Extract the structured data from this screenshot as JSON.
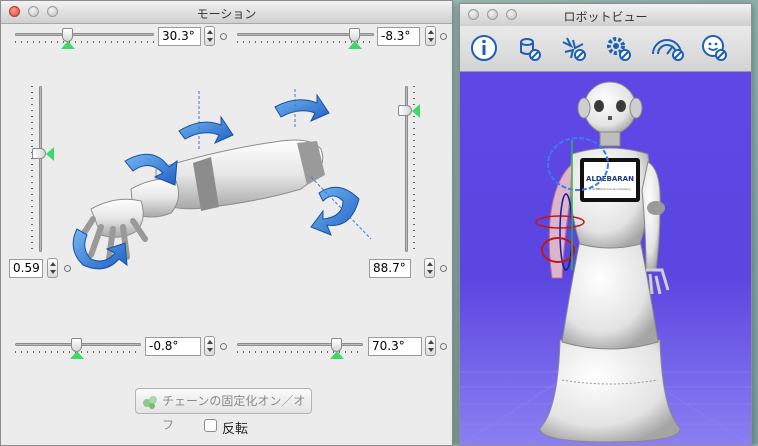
{
  "motion_window": {
    "title": "モーション",
    "sliders": {
      "top_left": {
        "value": "30.3°",
        "level": 0.38
      },
      "top_right": {
        "value": "-8.3°",
        "level": 0.86
      },
      "left_vert": {
        "value": "0.59",
        "level": 0.41
      },
      "right_vert": {
        "value": "88.7°",
        "level": 0.15
      },
      "bot_left": {
        "value": "-0.8°",
        "level": 0.49
      },
      "bot_right": {
        "value": "70.3°",
        "level": 0.79
      }
    },
    "chain_lock_button": "チェーンの固定化オン／オフ",
    "mirror_checkbox": {
      "label": "反転",
      "checked": false
    }
  },
  "robot_window": {
    "title": "ロボットビュー",
    "toolbar_icons": [
      "info-icon",
      "joint-display-off-icon",
      "collision-off-icon",
      "settings-off-icon",
      "dashboard-off-icon",
      "face-off-icon"
    ],
    "chest_tablet_text": "ALDEBARAN",
    "chest_tablet_subtext": "A SoftBank Group Company"
  },
  "colors": {
    "accent_green": "#3fd76a",
    "rotation_arrow_blue": "#2f7fd8",
    "viewport_purple": "#5f47e6"
  }
}
